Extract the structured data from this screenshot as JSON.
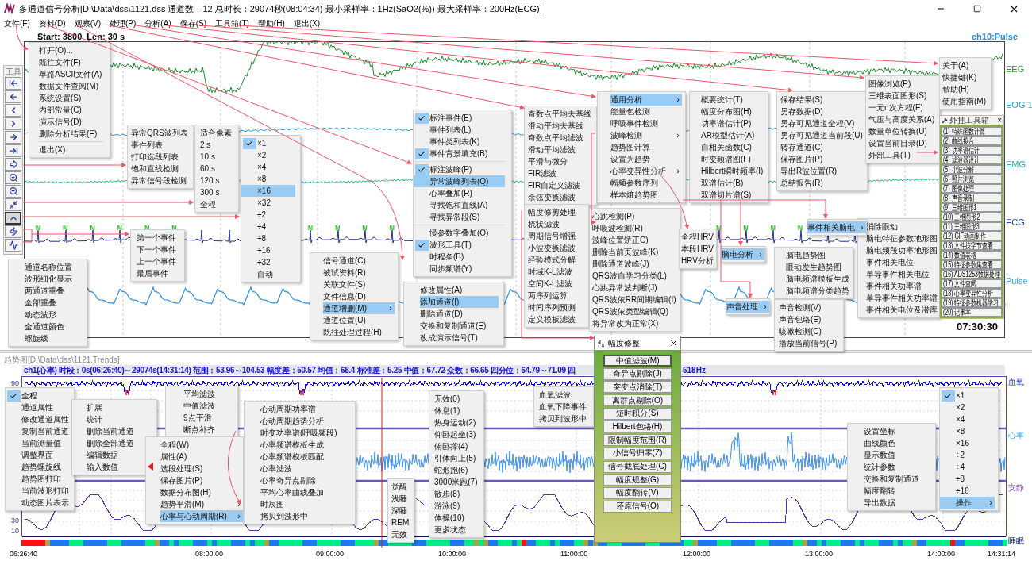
{
  "window": {
    "title": "多通道信号分析[D:\\Data\\dss\\1121.dss 通道数：12 总时长：29074秒(08:04:34) 最小采样率：1Hz(SaO2(%)) 最大采样率：200Hz(ECG)]"
  },
  "menubar": [
    "文件(F)",
    "资料(D)",
    "观察(V)",
    "处理(P)",
    "分析(A)",
    "保存(S)",
    "工具箱(T)",
    "帮助(H)",
    "退出(X)"
  ],
  "wave_view": {
    "header": "Start: 3800  Len: 30 s",
    "channel_title": "ch10:Pulse",
    "channels": [
      "EEG",
      "EOG 1",
      "EMG",
      "ECG",
      "Pulse"
    ],
    "beat_labels": [
      "N",
      "N",
      "N",
      "N",
      "N",
      "N",
      "N",
      "N",
      "N",
      "N",
      "N",
      "N",
      "N",
      "N"
    ],
    "time": "07:30:30"
  },
  "toolbar": {
    "label": "工具",
    "buttons": [
      {
        "selected": false
      },
      {
        "selected": false
      },
      {
        "selected": false
      },
      {
        "selected": false
      },
      {
        "selected": false
      },
      {
        "selected": false
      },
      {
        "selected": false
      },
      {
        "selected": false
      },
      {
        "selected": false
      },
      {
        "selected": false
      },
      {
        "selected": true
      },
      {
        "selected": false
      },
      {
        "selected": false
      }
    ]
  },
  "menus": [
    {
      "groups": [
        [
          {
            "label": "打开(O)..."
          },
          {
            "label": "既往文件(F)"
          },
          {
            "label": "单路ASCII文件(A)"
          },
          {
            "label": "数据文件查阅(M)"
          },
          {
            "label": "系统设置(S)"
          },
          {
            "label": "内部常量(C)"
          },
          {
            "label": "演示信号(D)"
          },
          {
            "label": "删除分析结果(E)"
          }
        ],
        [
          {
            "label": "退出(X)"
          }
        ]
      ]
    },
    {
      "groups": [
        [
          {
            "label": "异常QRS波列表"
          },
          {
            "label": "事件列表"
          },
          {
            "label": "打印选段列表"
          },
          {
            "label": "饱和直线检测"
          },
          {
            "label": "异常信号段检测"
          }
        ]
      ]
    },
    {
      "groups": [
        [
          {
            "label": "适合像素"
          },
          {
            "label": "2 s"
          },
          {
            "label": "10 s"
          },
          {
            "label": "60 s"
          },
          {
            "label": "120 s"
          },
          {
            "label": "300 s"
          },
          {
            "label": "全程"
          }
        ]
      ]
    },
    {
      "groups": [
        [
          {
            "label": "第一个事件"
          },
          {
            "label": "下一个事件"
          },
          {
            "label": "上一个事件"
          },
          {
            "label": "最后事件"
          }
        ]
      ]
    },
    {
      "groups": [
        [
          {
            "label": "×1",
            "checked": true,
            "selected": false
          },
          {
            "label": "×2",
            "checked": false,
            "selected": false
          },
          {
            "label": "×4",
            "checked": false,
            "selected": false
          },
          {
            "label": "×8",
            "checked": false,
            "selected": false
          },
          {
            "label": "×16",
            "checked": false,
            "selected": true
          },
          {
            "label": "×32",
            "checked": false,
            "selected": false
          },
          {
            "label": "÷2",
            "checked": false,
            "selected": false
          },
          {
            "label": "÷4",
            "checked": false,
            "selected": false
          },
          {
            "label": "÷8",
            "checked": false,
            "selected": false
          },
          {
            "label": "÷16",
            "checked": false,
            "selected": false
          },
          {
            "label": "÷32",
            "checked": false,
            "selected": false
          },
          {
            "label": "自动",
            "checked": false,
            "selected": false
          }
        ]
      ]
    },
    {
      "groups": [
        [
          {
            "label": "通道名称位置"
          },
          {
            "label": "波形细化显示"
          },
          {
            "label": "两通道重叠"
          },
          {
            "label": "全部重叠"
          },
          {
            "label": "动态波形"
          },
          {
            "label": "全通道颜色"
          },
          {
            "label": "螺旋线"
          }
        ]
      ]
    },
    {
      "groups": [
        [
          {
            "label": "标注事件(E)",
            "checked": true,
            "selected": false
          },
          {
            "label": "事件列表(L)",
            "checked": false,
            "selected": false
          },
          {
            "label": "事件类列表(K)",
            "checked": false,
            "selected": false
          },
          {
            "label": "事件背景填充(B)",
            "checked": true,
            "selected": false
          }
        ],
        [
          {
            "label": "标注波峰(P)",
            "checked": true,
            "selected": false
          },
          {
            "label": "异常波峰列表(Q)",
            "checked": false,
            "selected": true
          },
          {
            "label": "心率叠加(R)",
            "checked": false,
            "selected": false
          },
          {
            "label": "寻找饱和直线(A)",
            "checked": false,
            "selected": false
          },
          {
            "label": "寻找异常段(S)",
            "checked": false,
            "selected": false
          }
        ],
        [
          {
            "label": "慢参数字叠加(O)",
            "checked": false,
            "selected": false
          },
          {
            "label": "波形工具(T)",
            "checked": true,
            "selected": false
          },
          {
            "label": "时程条(B)",
            "checked": false,
            "selected": false
          },
          {
            "label": "同步频谱(Y)",
            "checked": false,
            "selected": false
          }
        ]
      ]
    },
    {
      "groups": [
        [
          {
            "label": "信号通道(C)",
            "selected": false
          },
          {
            "label": "被试资料(R)",
            "selected": false
          },
          {
            "label": "关联文件(S)",
            "selected": false
          },
          {
            "label": "文件信息(D)",
            "selected": false
          },
          {
            "label": "通道增删(M)",
            "arrow": "›",
            "selected": true
          },
          {
            "label": "通道位置(U)",
            "selected": false
          },
          {
            "label": "既往处理过程(H)",
            "selected": false
          }
        ]
      ]
    },
    {
      "groups": [
        [
          {
            "label": "修改属性(A)",
            "selected": false
          },
          {
            "label": "添加通道(I)",
            "selected": true
          },
          {
            "label": "删除通道(D)",
            "selected": false
          },
          {
            "label": "交换和复制通道(E)",
            "selected": false
          },
          {
            "label": "改成演示信号(T)",
            "selected": false
          }
        ]
      ]
    },
    {
      "groups": [
        [
          {
            "label": "奇数点平均去基线"
          },
          {
            "label": "滑动平均去基线"
          },
          {
            "label": "奇数点平均滤波"
          },
          {
            "label": "滑动平均滤波"
          },
          {
            "label": "平滑与微分"
          },
          {
            "label": "FIR滤波"
          },
          {
            "label": "FIR自定义滤波"
          },
          {
            "label": "余弦变换滤波"
          }
        ]
      ]
    },
    {
      "groups": [
        [
          {
            "label": "幅度修剪处理"
          },
          {
            "label": "梳状滤波"
          },
          {
            "label": "周期信号增强"
          },
          {
            "label": "小波变换滤波"
          },
          {
            "label": "经验模式分解"
          },
          {
            "label": "时域K-L滤波"
          },
          {
            "label": "空间K-L滤波"
          },
          {
            "label": "两序列运算"
          },
          {
            "label": "时间序列预测"
          },
          {
            "label": "定义模板滤波"
          }
        ]
      ]
    },
    {
      "groups": [
        [
          {
            "label": "通用分析",
            "arrow": "›",
            "selected": true
          },
          {
            "label": "能量包检测",
            "selected": false
          },
          {
            "label": "呼吸事件检测",
            "selected": false
          },
          {
            "label": "波峰检测",
            "arrow": "›",
            "selected": false
          },
          {
            "label": "趋势图计算",
            "selected": false
          },
          {
            "label": "设置为趋势",
            "selected": false
          },
          {
            "label": "心率变异性分析",
            "arrow": "›",
            "selected": false
          },
          {
            "label": "幅频参数序列",
            "selected": false
          },
          {
            "label": "样本熵趋势图",
            "selected": false
          }
        ]
      ]
    },
    {
      "groups": [
        [
          {
            "label": "概要统计(T)"
          },
          {
            "label": "幅度分布图(H)"
          },
          {
            "label": "功率谱估计(P)"
          },
          {
            "label": "AR模型估计(A)"
          },
          {
            "label": "自相关函数(C)"
          },
          {
            "label": "时变频谱图(F)"
          },
          {
            "label": "Hilbert瞬时频率(I)"
          },
          {
            "label": "双谱估计(B)"
          },
          {
            "label": "双谱切片谱(S)"
          }
        ]
      ]
    },
    {
      "groups": [
        [
          {
            "label": "心跳检测(P)"
          },
          {
            "label": "呼吸波检测(R)"
          },
          {
            "label": "波峰位置矫正C)"
          },
          {
            "label": "删除当前页波峰(K)"
          },
          {
            "label": "删除通道波峰(J)"
          },
          {
            "label": "QRS波自学习分类(L)"
          },
          {
            "label": "心跳异常波判断(J)"
          },
          {
            "label": "QRS波依RR间期编辑(I)"
          },
          {
            "label": "QRS波依类型编辑(Q)"
          },
          {
            "label": "将异常改为正常(X)"
          }
        ]
      ]
    },
    {
      "groups": [
        [
          {
            "label": "全程HRV"
          },
          {
            "label": "本段HRV"
          },
          {
            "label": "HRV分析"
          }
        ]
      ]
    },
    {
      "groups": [
        [
          {
            "label": "保存结果(S)"
          },
          {
            "label": "另存数据(D)"
          },
          {
            "label": "另存可见通道全程(V)"
          },
          {
            "label": "另存可见通道当前段(U)"
          },
          {
            "label": "转存通道(C)"
          },
          {
            "label": "保存图片(P)"
          },
          {
            "label": "导出R波位置(R)"
          },
          {
            "label": "总结报告(R)"
          }
        ]
      ]
    },
    {
      "groups": [
        [
          {
            "label": "图像浏览(P)"
          },
          {
            "label": "三维表面图形(S)"
          },
          {
            "label": "一元n次方程(E)"
          },
          {
            "label": "气压与高度关系(A)"
          },
          {
            "label": "数量单位转换(U)"
          },
          {
            "label": "设置当前目录(D)"
          },
          {
            "label": "外部工具(T)"
          }
        ]
      ]
    },
    {
      "groups": [
        [
          {
            "label": "关于(A)"
          },
          {
            "label": "快捷键(K)"
          },
          {
            "label": "帮助(H)"
          },
          {
            "label": "使用指南(M)"
          }
        ]
      ]
    },
    {
      "groups": [
        [
          {
            "label": "事件相关脑电",
            "arrow": "›",
            "selected": true
          }
        ]
      ]
    },
    {
      "groups": [
        [
          {
            "label": "脑电分析",
            "arrow": "›",
            "selected": true
          }
        ]
      ]
    },
    {
      "groups": [
        [
          {
            "label": "声音处理",
            "arrow": "›",
            "selected": true
          }
        ]
      ]
    },
    {
      "groups": [
        [
          {
            "label": "脑电趋势图"
          },
          {
            "label": "眼动发生趋势图"
          },
          {
            "label": "脑电频谱模板生成"
          },
          {
            "label": "脑电频谱分类趋势"
          }
        ]
      ]
    },
    {
      "groups": [
        [
          {
            "label": "消除眼动"
          },
          {
            "label": "脑电特征参数地形图"
          },
          {
            "label": "脑电频段功率地形图"
          },
          {
            "label": "事件相关电位"
          },
          {
            "label": "单导事件相关电位"
          },
          {
            "label": "事件相关功率谱"
          },
          {
            "label": "单导事件相关功率谱"
          },
          {
            "label": "事件相关电位及潜库"
          }
        ]
      ]
    },
    {
      "groups": [
        [
          {
            "label": "声音检测(V)"
          },
          {
            "label": "声音包络(E)"
          },
          {
            "label": "咳嗽检测(C)"
          },
          {
            "label": "播放当前信号(P)"
          }
        ]
      ]
    },
    {
      "groups": [
        [
          {
            "label": "全程",
            "checked": true
          },
          {
            "label": "通道属性",
            "checked": false
          },
          {
            "label": "修改通道属性",
            "checked": false
          },
          {
            "label": "复制当前通道",
            "checked": false
          },
          {
            "label": "当前测量值",
            "checked": false
          },
          {
            "label": "调整界面",
            "checked": false
          },
          {
            "label": "趋势螺旋线",
            "checked": false
          },
          {
            "label": "趋势图打印",
            "checked": false
          },
          {
            "label": "当前波形打印",
            "checked": false
          },
          {
            "label": "动态图片表示",
            "checked": false
          }
        ]
      ]
    },
    {
      "groups": [
        [
          {
            "label": "扩展"
          },
          {
            "label": "统计"
          },
          {
            "label": "删除当前通道"
          },
          {
            "label": "删除全部通道"
          },
          {
            "label": "编辑数据"
          },
          {
            "label": "输入数值"
          }
        ]
      ]
    },
    {
      "groups": [
        [
          {
            "label": "平均滤波"
          },
          {
            "label": "中值滤波"
          },
          {
            "label": "9点平滑"
          },
          {
            "label": "断点补齐"
          }
        ]
      ]
    },
    {
      "groups": [
        [
          {
            "label": "全程(W)",
            "selected": false
          },
          {
            "label": "属性(A)",
            "selected": false
          },
          {
            "label": "选段处理(S)",
            "selected": false
          },
          {
            "label": "保存图片(P)",
            "selected": false
          },
          {
            "label": "数据分布图(H)",
            "selected": false
          },
          {
            "label": "趋势平滑(M)",
            "arrow": "›",
            "selected": false
          },
          {
            "label": "心率与心动周期(R)",
            "arrow": "›",
            "selected": true
          }
        ]
      ]
    },
    {
      "groups": [
        [
          {
            "label": "心动周期功率谱"
          },
          {
            "label": "心动周期趋势分析"
          },
          {
            "label": "时变功率谱(呼吸频段)"
          },
          {
            "label": "心率频谱模板生成"
          },
          {
            "label": "心率频谱模板匹配"
          },
          {
            "label": "心率滤波"
          },
          {
            "label": "心率奇异点剔除"
          },
          {
            "label": "平均心率曲线叠加"
          },
          {
            "label": "时辰图"
          },
          {
            "label": "拷贝到波形中"
          }
        ]
      ]
    },
    {
      "groups": [
        [
          {
            "label": "觉醒"
          },
          {
            "label": "浅睡"
          },
          {
            "label": "深睡"
          },
          {
            "label": "REM"
          },
          {
            "label": "无效"
          }
        ]
      ]
    },
    {
      "groups": [
        [
          {
            "label": "无效(0)"
          },
          {
            "label": "休息(1)"
          },
          {
            "label": "热身运动(2)"
          },
          {
            "label": "仰卧起坐(3)"
          },
          {
            "label": "俯卧撑(4)"
          },
          {
            "label": "引体向上(5)"
          },
          {
            "label": "蛇形跑(6)"
          },
          {
            "label": "3000米跑(7)"
          },
          {
            "label": "散步(8)"
          },
          {
            "label": "游泳(9)"
          },
          {
            "label": "体操(10)"
          },
          {
            "label": "更多状态"
          }
        ]
      ]
    },
    {
      "groups": [
        [
          {
            "label": "血氧滤波"
          },
          {
            "label": "血氧下降事件"
          },
          {
            "label": "拷贝到波形中"
          }
        ]
      ]
    },
    {
      "groups": [
        [
          {
            "label": "设置坐标"
          },
          {
            "label": "曲线颜色"
          },
          {
            "label": "显示数值"
          },
          {
            "label": "统计参数"
          },
          {
            "label": "交换和复制通道"
          },
          {
            "label": "幅度翻转"
          },
          {
            "label": "导出数据"
          }
        ]
      ]
    },
    {
      "groups": [
        [
          {
            "label": "×1",
            "checked": true,
            "selected": false
          },
          {
            "label": "×2",
            "checked": false,
            "selected": false
          },
          {
            "label": "×4",
            "checked": false,
            "selected": false
          },
          {
            "label": "×8",
            "checked": false,
            "selected": false
          },
          {
            "label": "×16",
            "checked": false,
            "selected": false
          },
          {
            "label": "÷2",
            "checked": false,
            "selected": false
          },
          {
            "label": "÷4",
            "checked": false,
            "selected": false
          },
          {
            "label": "÷8",
            "checked": false,
            "selected": false
          },
          {
            "label": "÷16",
            "checked": false,
            "selected": false
          },
          {
            "label": "操作",
            "arrow": "›",
            "checked": false,
            "selected": true
          }
        ]
      ]
    }
  ],
  "tool_panel": {
    "title": "外挂工具箱",
    "close": "×",
    "items": [
      "(1) 特殊函数计算",
      "(2) 曲线拟合",
      "(3) 功率谱估计",
      "(4) 滤波器设计",
      "(5) 小波分解",
      "(6) 照片浏览",
      "(7) 图像处理",
      "(8) 声音录制",
      "(9) 三维图形1",
      "(10) 三维图形2",
      "(11) 三维图形3",
      "(12) GIF动画制作",
      "(13) 文件按字节查看",
      "(14) 数值表格",
      "(15) 特征参数集查看",
      "(16) ADS1253数据处理",
      "(17) 文件查阅",
      "(18) 心率变异性分析",
      "(19) 特征参数机器学习",
      "(20) 记事本"
    ]
  },
  "dialog": {
    "title": "幅度修整",
    "buttons": [
      {
        "label": "中值滤波(M)",
        "selected": true
      },
      {
        "label": "奇异点剔除(J)",
        "selected": false
      },
      {
        "label": "突变点消除(T)",
        "selected": false
      },
      {
        "label": "离群点剔除(O)",
        "selected": false
      },
      {
        "label": "短时积分(S)",
        "selected": false
      },
      {
        "label": "Hilbert包络(H)",
        "selected": false
      },
      {
        "label": "限制幅度范围(R)",
        "selected": false
      },
      {
        "label": "小信号归零(Z)",
        "selected": false
      },
      {
        "label": "信号截底处理(C)",
        "selected": false
      },
      {
        "label": "幅度规整(G)",
        "selected": false
      },
      {
        "label": "幅度翻转(V)",
        "selected": false
      },
      {
        "label": "还原信号(O)",
        "selected": false
      }
    ]
  },
  "trend_view": {
    "title": "趋势图[D:\\Data\\dss\\1121.Trends]",
    "stats": "ch1(心率) 时段：0s(06:26:40)～29074s(14:31:14) 范围：53.96～104.53 幅度差：50.57 均值：68.4 标准差：5.25 中值：67.72 众数：66.65 四分位：64.79～71.09 四",
    "stats_tail": "518Hz",
    "channel_labels": [
      "血氧",
      "心率",
      "安静",
      "睡眠"
    ],
    "y_ticks": [
      "90",
      "30",
      "10"
    ],
    "time_labels": [
      "06:26:40",
      "08:00:00",
      "09:00:00",
      "10:00:00",
      "11:00:00",
      "12:00:00",
      "13:00:00",
      "14:00:00",
      "14:31:14"
    ]
  }
}
